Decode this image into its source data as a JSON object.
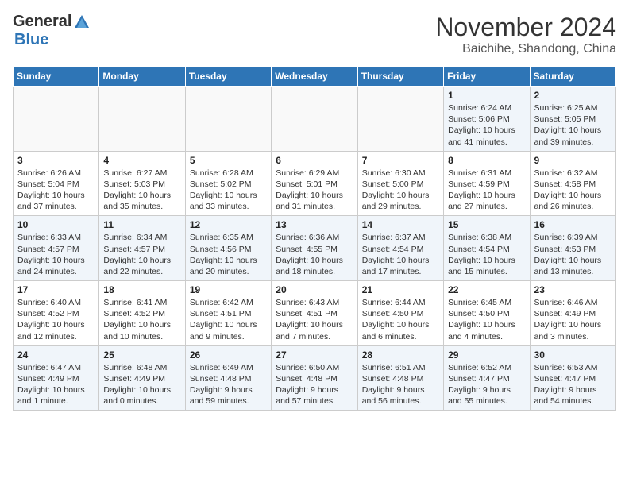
{
  "header": {
    "logo_general": "General",
    "logo_blue": "Blue",
    "month_title": "November 2024",
    "location": "Baichihe, Shandong, China"
  },
  "days_of_week": [
    "Sunday",
    "Monday",
    "Tuesday",
    "Wednesday",
    "Thursday",
    "Friday",
    "Saturday"
  ],
  "weeks": [
    [
      {
        "day": "",
        "info": ""
      },
      {
        "day": "",
        "info": ""
      },
      {
        "day": "",
        "info": ""
      },
      {
        "day": "",
        "info": ""
      },
      {
        "day": "",
        "info": ""
      },
      {
        "day": "1",
        "info": "Sunrise: 6:24 AM\nSunset: 5:06 PM\nDaylight: 10 hours and 41 minutes."
      },
      {
        "day": "2",
        "info": "Sunrise: 6:25 AM\nSunset: 5:05 PM\nDaylight: 10 hours and 39 minutes."
      }
    ],
    [
      {
        "day": "3",
        "info": "Sunrise: 6:26 AM\nSunset: 5:04 PM\nDaylight: 10 hours and 37 minutes."
      },
      {
        "day": "4",
        "info": "Sunrise: 6:27 AM\nSunset: 5:03 PM\nDaylight: 10 hours and 35 minutes."
      },
      {
        "day": "5",
        "info": "Sunrise: 6:28 AM\nSunset: 5:02 PM\nDaylight: 10 hours and 33 minutes."
      },
      {
        "day": "6",
        "info": "Sunrise: 6:29 AM\nSunset: 5:01 PM\nDaylight: 10 hours and 31 minutes."
      },
      {
        "day": "7",
        "info": "Sunrise: 6:30 AM\nSunset: 5:00 PM\nDaylight: 10 hours and 29 minutes."
      },
      {
        "day": "8",
        "info": "Sunrise: 6:31 AM\nSunset: 4:59 PM\nDaylight: 10 hours and 27 minutes."
      },
      {
        "day": "9",
        "info": "Sunrise: 6:32 AM\nSunset: 4:58 PM\nDaylight: 10 hours and 26 minutes."
      }
    ],
    [
      {
        "day": "10",
        "info": "Sunrise: 6:33 AM\nSunset: 4:57 PM\nDaylight: 10 hours and 24 minutes."
      },
      {
        "day": "11",
        "info": "Sunrise: 6:34 AM\nSunset: 4:57 PM\nDaylight: 10 hours and 22 minutes."
      },
      {
        "day": "12",
        "info": "Sunrise: 6:35 AM\nSunset: 4:56 PM\nDaylight: 10 hours and 20 minutes."
      },
      {
        "day": "13",
        "info": "Sunrise: 6:36 AM\nSunset: 4:55 PM\nDaylight: 10 hours and 18 minutes."
      },
      {
        "day": "14",
        "info": "Sunrise: 6:37 AM\nSunset: 4:54 PM\nDaylight: 10 hours and 17 minutes."
      },
      {
        "day": "15",
        "info": "Sunrise: 6:38 AM\nSunset: 4:54 PM\nDaylight: 10 hours and 15 minutes."
      },
      {
        "day": "16",
        "info": "Sunrise: 6:39 AM\nSunset: 4:53 PM\nDaylight: 10 hours and 13 minutes."
      }
    ],
    [
      {
        "day": "17",
        "info": "Sunrise: 6:40 AM\nSunset: 4:52 PM\nDaylight: 10 hours and 12 minutes."
      },
      {
        "day": "18",
        "info": "Sunrise: 6:41 AM\nSunset: 4:52 PM\nDaylight: 10 hours and 10 minutes."
      },
      {
        "day": "19",
        "info": "Sunrise: 6:42 AM\nSunset: 4:51 PM\nDaylight: 10 hours and 9 minutes."
      },
      {
        "day": "20",
        "info": "Sunrise: 6:43 AM\nSunset: 4:51 PM\nDaylight: 10 hours and 7 minutes."
      },
      {
        "day": "21",
        "info": "Sunrise: 6:44 AM\nSunset: 4:50 PM\nDaylight: 10 hours and 6 minutes."
      },
      {
        "day": "22",
        "info": "Sunrise: 6:45 AM\nSunset: 4:50 PM\nDaylight: 10 hours and 4 minutes."
      },
      {
        "day": "23",
        "info": "Sunrise: 6:46 AM\nSunset: 4:49 PM\nDaylight: 10 hours and 3 minutes."
      }
    ],
    [
      {
        "day": "24",
        "info": "Sunrise: 6:47 AM\nSunset: 4:49 PM\nDaylight: 10 hours and 1 minute."
      },
      {
        "day": "25",
        "info": "Sunrise: 6:48 AM\nSunset: 4:49 PM\nDaylight: 10 hours and 0 minutes."
      },
      {
        "day": "26",
        "info": "Sunrise: 6:49 AM\nSunset: 4:48 PM\nDaylight: 9 hours and 59 minutes."
      },
      {
        "day": "27",
        "info": "Sunrise: 6:50 AM\nSunset: 4:48 PM\nDaylight: 9 hours and 57 minutes."
      },
      {
        "day": "28",
        "info": "Sunrise: 6:51 AM\nSunset: 4:48 PM\nDaylight: 9 hours and 56 minutes."
      },
      {
        "day": "29",
        "info": "Sunrise: 6:52 AM\nSunset: 4:47 PM\nDaylight: 9 hours and 55 minutes."
      },
      {
        "day": "30",
        "info": "Sunrise: 6:53 AM\nSunset: 4:47 PM\nDaylight: 9 hours and 54 minutes."
      }
    ]
  ]
}
